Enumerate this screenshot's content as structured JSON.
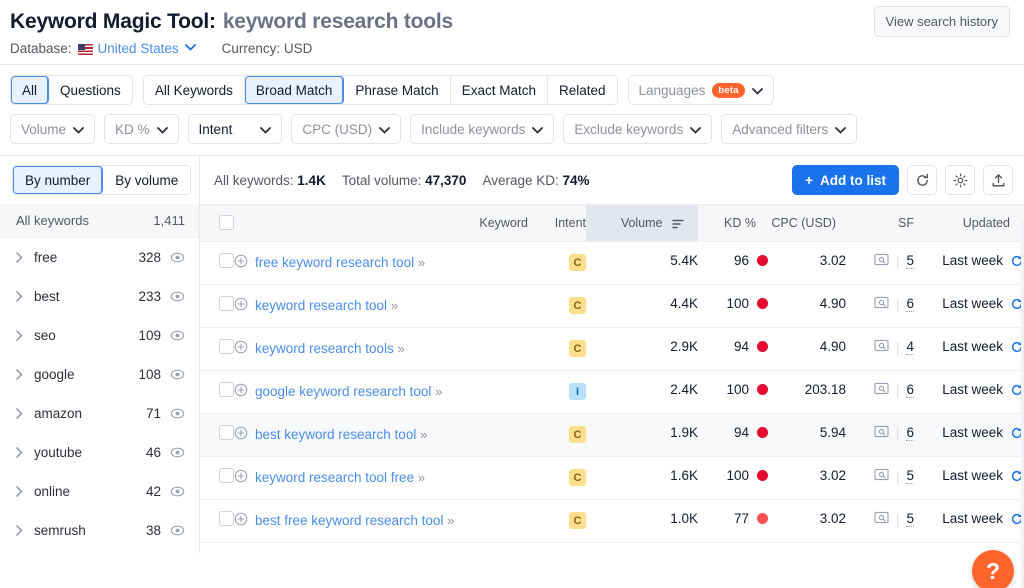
{
  "header": {
    "title": "Keyword Magic Tool:",
    "query": "keyword research tools",
    "database_label": "Database:",
    "database_value": "United States",
    "currency": "Currency: USD",
    "history_button": "View search history"
  },
  "match_tabs": {
    "group1": [
      {
        "label": "All",
        "active": true
      },
      {
        "label": "Questions",
        "active": false
      }
    ],
    "group2": [
      {
        "label": "All Keywords",
        "active": false
      },
      {
        "label": "Broad Match",
        "active": true
      },
      {
        "label": "Phrase Match",
        "active": false
      },
      {
        "label": "Exact Match",
        "active": false
      },
      {
        "label": "Related",
        "active": false
      }
    ],
    "languages": {
      "label": "Languages",
      "badge": "beta"
    }
  },
  "filters": [
    {
      "label": "Volume"
    },
    {
      "label": "KD %"
    },
    {
      "label": "Intent"
    },
    {
      "label": "CPC (USD)"
    },
    {
      "label": "Include keywords"
    },
    {
      "label": "Exclude keywords"
    },
    {
      "label": "Advanced filters"
    }
  ],
  "sidebar": {
    "toggle": [
      {
        "label": "By number",
        "active": true
      },
      {
        "label": "By volume",
        "active": false
      }
    ],
    "all_keywords_label": "All keywords",
    "all_keywords_count": "1,411",
    "items": [
      {
        "label": "free",
        "count": "328"
      },
      {
        "label": "best",
        "count": "233"
      },
      {
        "label": "seo",
        "count": "109"
      },
      {
        "label": "google",
        "count": "108"
      },
      {
        "label": "amazon",
        "count": "71"
      },
      {
        "label": "youtube",
        "count": "46"
      },
      {
        "label": "online",
        "count": "42"
      },
      {
        "label": "semrush",
        "count": "38"
      }
    ]
  },
  "results": {
    "stats": [
      {
        "label": "All keywords:",
        "value": "1.4K"
      },
      {
        "label": "Total volume:",
        "value": "47,370"
      },
      {
        "label": "Average KD:",
        "value": "74%"
      }
    ],
    "add_to_list": "Add to list",
    "add_plus": "+",
    "columns": {
      "keyword": "Keyword",
      "intent": "Intent",
      "volume": "Volume",
      "kd": "KD %",
      "cpc": "CPC (USD)",
      "sf": "SF",
      "updated": "Updated"
    },
    "rows": [
      {
        "keyword": "free keyword research tool",
        "intent": "C",
        "volume": "5.4K",
        "kd": "96",
        "kd_color": "#e5092f",
        "cpc": "3.02",
        "sf": "5",
        "updated": "Last week"
      },
      {
        "keyword": "keyword research tool",
        "intent": "C",
        "volume": "4.4K",
        "kd": "100",
        "kd_color": "#e5092f",
        "cpc": "4.90",
        "sf": "6",
        "updated": "Last week"
      },
      {
        "keyword": "keyword research tools",
        "intent": "C",
        "volume": "2.9K",
        "kd": "94",
        "kd_color": "#e5092f",
        "cpc": "4.90",
        "sf": "4",
        "updated": "Last week"
      },
      {
        "keyword": "google keyword research tool",
        "intent": "I",
        "volume": "2.4K",
        "kd": "100",
        "kd_color": "#e5092f",
        "cpc": "203.18",
        "sf": "6",
        "updated": "Last week"
      },
      {
        "keyword": "best keyword research tool",
        "intent": "C",
        "volume": "1.9K",
        "kd": "94",
        "kd_color": "#e5092f",
        "cpc": "5.94",
        "sf": "6",
        "updated": "Last week"
      },
      {
        "keyword": "keyword research tool free",
        "intent": "C",
        "volume": "1.6K",
        "kd": "100",
        "kd_color": "#e5092f",
        "cpc": "3.02",
        "sf": "5",
        "updated": "Last week"
      },
      {
        "keyword": "best free keyword research tool",
        "intent": "C",
        "volume": "1.0K",
        "kd": "77",
        "kd_color": "#fc5050",
        "cpc": "3.02",
        "sf": "5",
        "updated": "Last week"
      }
    ]
  },
  "help": {
    "label": "?"
  },
  "colors": {
    "accent_blue": "#1a73ec",
    "link_blue": "#4a8de8",
    "orange": "#ff642d",
    "intent_commercial": "#fcdf8a",
    "intent_informational": "#b9e0fb"
  }
}
